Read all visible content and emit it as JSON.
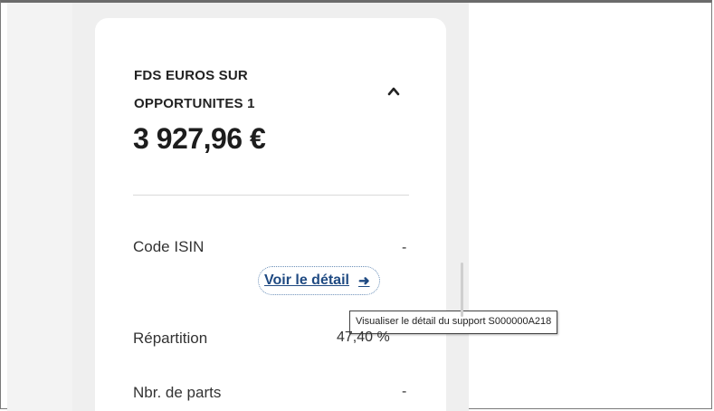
{
  "fund": {
    "name": "FDS EUROS SUR OPPORTUNITES 1",
    "amount": "3 927,96 €"
  },
  "details": {
    "isin_label": "Code ISIN",
    "isin_value": "-",
    "link_label": "Voir le détail",
    "tooltip": "Visualiser le détail du support S000000A218",
    "repartition_label": "Répartition",
    "repartition_value": "47,40 %",
    "parts_label": "Nbr. de parts",
    "parts_value": "-"
  },
  "icons": {
    "collapse": "chevron-up-icon",
    "link_arrow": "arrow-right-icon"
  },
  "colors": {
    "link": "#1f4a82",
    "panel_background": "#efefef"
  }
}
